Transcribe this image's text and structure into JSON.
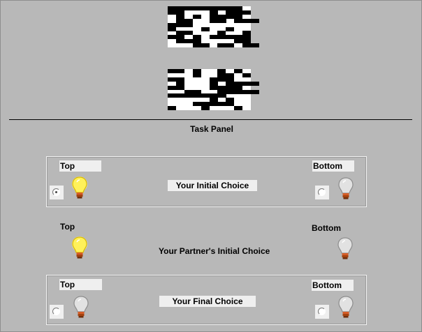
{
  "task_panel": {
    "title": "Task Panel"
  },
  "initial_choice": {
    "top_label": "Top",
    "bottom_label": "Bottom",
    "center_label": "Your Initial Choice",
    "top_selected": true,
    "top_bulb_state": "lit",
    "bottom_bulb_state": "off",
    "icons": [
      "radio-top-icon",
      "lightbulb-on-icon",
      "radio-bottom-icon",
      "lightbulb-off-icon"
    ]
  },
  "partner_choice": {
    "top_label": "Top",
    "bottom_label": "Bottom",
    "center_label": "Your Partner's Initial Choice",
    "top_bulb_state": "lit",
    "bottom_bulb_state": "off"
  },
  "final_choice": {
    "top_label": "Top",
    "bottom_label": "Bottom",
    "center_label": "Your Final Choice",
    "top_selected": false,
    "bottom_selected": false,
    "top_bulb_state": "off",
    "bottom_bulb_state": "off"
  },
  "colors": {
    "background": "#b8b8b8",
    "label_background": "#efefef",
    "bulb_on": "#fff15a",
    "bulb_off": "#e2e2e2"
  }
}
